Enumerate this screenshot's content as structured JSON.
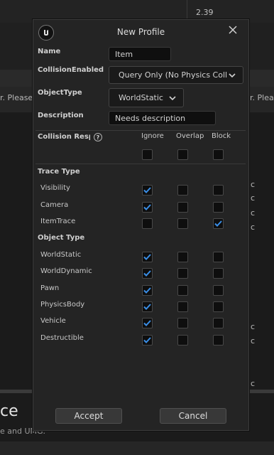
{
  "background": {
    "top_value": "2.39",
    "left_fragment": "r. Please",
    "right_fragment": "r. Pleas",
    "right_column_fragments": [
      "ic",
      "ic",
      "ic",
      "ic",
      "ic",
      "ic",
      "ic"
    ],
    "big_title": "ce",
    "subtitle": "e and UMG."
  },
  "dialog": {
    "title": "New Profile",
    "logo_icon": "unreal-logo-icon",
    "close_icon": "close-icon",
    "fields": {
      "name_label": "Name",
      "name_value": "Item",
      "collision_label": "CollisionEnabled",
      "collision_value": "Query Only (No Physics Coll",
      "objecttype_label": "ObjectType",
      "objecttype_value": "WorldStatic",
      "description_label": "Description",
      "description_value": "Needs description"
    },
    "responses": {
      "header_label": "Collision Resp",
      "help_glyph": "?",
      "columns": [
        "Ignore",
        "Overlap",
        "Block"
      ],
      "trace_section": "Trace Type",
      "object_section": "Object Type",
      "trace_rows": [
        {
          "name": "Visibility",
          "ignore": true,
          "overlap": false,
          "block": false
        },
        {
          "name": "Camera",
          "ignore": true,
          "overlap": false,
          "block": false
        },
        {
          "name": "ItemTrace",
          "ignore": false,
          "overlap": false,
          "block": true
        }
      ],
      "object_rows": [
        {
          "name": "WorldStatic",
          "ignore": true,
          "overlap": false,
          "block": false
        },
        {
          "name": "WorldDynamic",
          "ignore": true,
          "overlap": false,
          "block": false
        },
        {
          "name": "Pawn",
          "ignore": true,
          "overlap": false,
          "block": false
        },
        {
          "name": "PhysicsBody",
          "ignore": true,
          "overlap": false,
          "block": false
        },
        {
          "name": "Vehicle",
          "ignore": true,
          "overlap": false,
          "block": false
        },
        {
          "name": "Destructible",
          "ignore": true,
          "overlap": false,
          "block": false
        }
      ]
    },
    "buttons": {
      "accept": "Accept",
      "cancel": "Cancel"
    },
    "colors": {
      "check_accent": "#3a8ee6",
      "panel": "#242424",
      "field_bg": "#0f0f0f"
    }
  }
}
